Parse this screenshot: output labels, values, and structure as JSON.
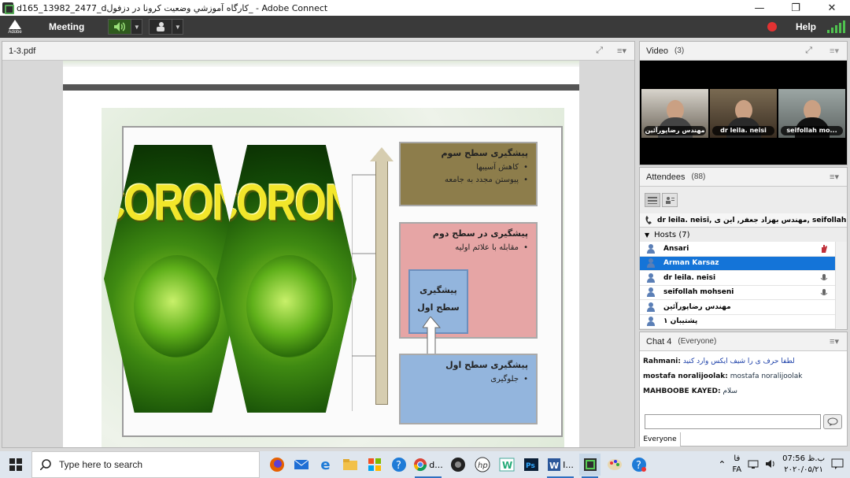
{
  "window": {
    "title": "d165_13982_2477_dکارگاه آموزشي وضعيت کرونا در دزفول_ - Adobe Connect",
    "minimize_label": "—",
    "restore_label": "❐",
    "close_label": "✕"
  },
  "menubar": {
    "logo_text": "Adobe",
    "meeting_label": "Meeting",
    "help_label": "Help",
    "recording_color": "#e23232",
    "audio_icon": "speaker-on-icon",
    "camera_icon": "webcam-icon"
  },
  "share_pod": {
    "title": "1-3.pdf"
  },
  "slide": {
    "corona_text_left": "CORON",
    "corona_text_right": "CORONA",
    "level3": {
      "title": "پيشگيری سطح سوم",
      "items": [
        "کاهش آسيبها",
        "پيوستن مجدد به جامعه"
      ],
      "color": "#8d7d4b"
    },
    "level2": {
      "title": "پيشگيری در سطح دوم",
      "items": [
        "مقابله با علائم اوليه"
      ],
      "color": "#e6a5a5"
    },
    "level1_inner": {
      "line1": "پيشگيری",
      "line2": "سطح اول"
    },
    "level1": {
      "title": "پيشگيری سطح اول",
      "items": [
        "جلوگيری"
      ],
      "color": "#93b5dd"
    }
  },
  "video_pod": {
    "title": "Video",
    "count": "(3)",
    "tiles": [
      {
        "name": "مهندس رضاپورآئين"
      },
      {
        "name": "dr leila. neisi"
      },
      {
        "name": "seifollah mo..."
      }
    ]
  },
  "attendees_pod": {
    "title": "Attendees",
    "count": "(88)",
    "active_speakers": "dr leila. neisi, مهندس بهزاد جعفر, این ی, seifollah mohseni",
    "hosts_label": "Hosts (7)",
    "rows": [
      {
        "name": "Ansari",
        "status": "raised-hand-icon"
      },
      {
        "name": "Arman Karsaz",
        "status": ""
      },
      {
        "name": "dr leila. neisi",
        "status": "microphone-icon"
      },
      {
        "name": "seifollah mohseni",
        "status": "microphone-icon"
      },
      {
        "name": "مهندس رضاپورآئين",
        "status": ""
      },
      {
        "name": "پشتيبان ۱",
        "status": ""
      }
    ]
  },
  "chat_pod": {
    "title": "Chat 4",
    "scope": "(Everyone)",
    "messages": [
      {
        "who": "Rahmani:",
        "msg": "لطفا حرف ی را شیف ایکس وارد کنید"
      },
      {
        "who": "mostafa noralijoolak:",
        "msg": "mostafa noralijoolak"
      },
      {
        "who": "MAHBOOBE KAYED:",
        "msg": "سلام"
      }
    ],
    "input_placeholder": "",
    "tab_label": "Everyone"
  },
  "taskbar": {
    "search_placeholder": "Type here to search",
    "apps": [
      "firefox-icon",
      "mail-icon",
      "edge-icon",
      "file-explorer-icon",
      "store-icon",
      "help-icon",
      "chrome-icon",
      "camera-app-icon",
      "hp-icon",
      "winscp-icon",
      "photoshop-icon",
      "word-icon",
      "adobe-connect-icon",
      "paint-icon",
      "help-tray-icon"
    ],
    "chrome_label": "d...",
    "word_label": "I...",
    "lang_top": "فا",
    "lang_bottom": "FA",
    "time": "07:56 ب.ظ",
    "date": "۲۰۲۰/۰۵/۲۱"
  }
}
